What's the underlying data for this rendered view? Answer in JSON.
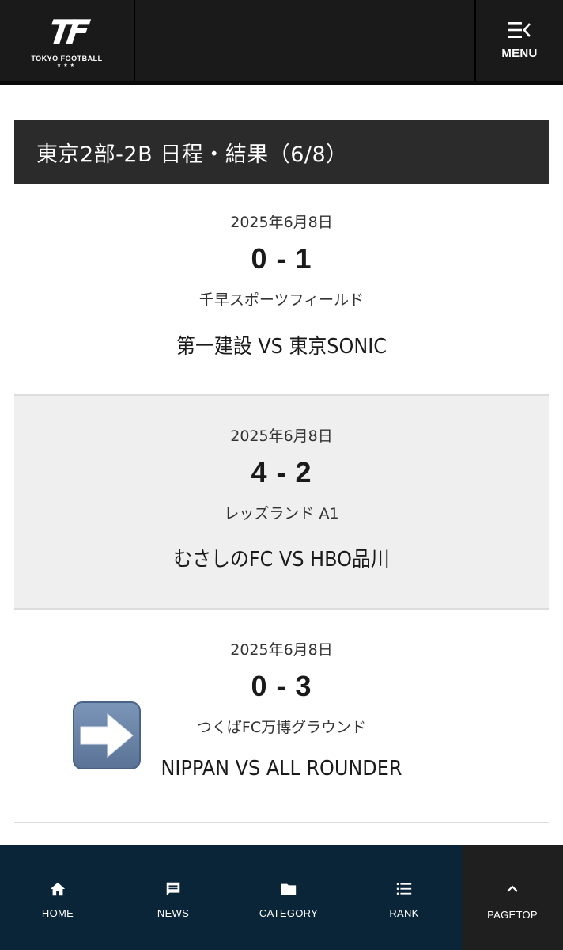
{
  "header": {
    "logo_mark": "TF",
    "logo_text": "TOKYO FOOTBALL",
    "logo_stars": "★★★",
    "menu_label": "MENU"
  },
  "section": {
    "title": "東京2部-2B 日程・結果（6/8）"
  },
  "matches": [
    {
      "date": "2025年6月8日",
      "score": "0 - 1",
      "venue": "千早スポーツフィールド",
      "teams": "第一建設 VS 東京SONIC"
    },
    {
      "date": "2025年6月8日",
      "score": "4 - 2",
      "venue": "レッズランド A1",
      "teams": "むさしのFC VS HBO品川"
    },
    {
      "date": "2025年6月8日",
      "score": "0 - 3",
      "venue": "つくばFC万博グラウンド",
      "teams": "NIPPAN VS ALL ROUNDER"
    }
  ],
  "nav": {
    "items": [
      {
        "label": "HOME",
        "icon": "home-icon"
      },
      {
        "label": "NEWS",
        "icon": "chat-icon"
      },
      {
        "label": "CATEGORY",
        "icon": "folder-icon"
      },
      {
        "label": "RANK",
        "icon": "list-icon"
      }
    ],
    "pagetop_label": "PAGETOP"
  },
  "colors": {
    "header_bg": "#1a1a1a",
    "title_bg": "#2b2b2b",
    "alt_row_bg": "#efefef",
    "nav_bg": "#0b2538",
    "pagetop_bg": "#1f1f1f"
  }
}
